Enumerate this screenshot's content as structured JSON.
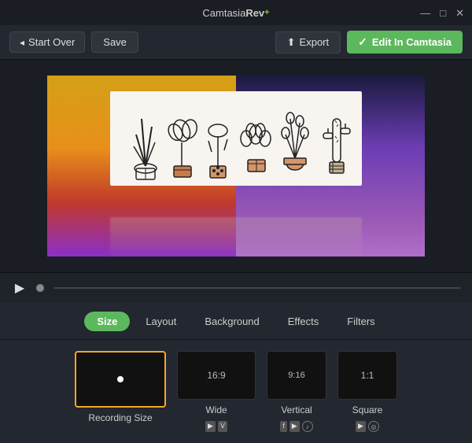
{
  "titleBar": {
    "appName": "Camtasia",
    "appNameBold": "Rev",
    "appPlus": "+",
    "controls": {
      "minimize": "—",
      "maximize": "□",
      "close": "✕"
    }
  },
  "toolbar": {
    "startOver": "Start Over",
    "save": "Save",
    "export": "Export",
    "editInCamtasia": "Edit In Camtasia"
  },
  "tabs": [
    {
      "id": "size",
      "label": "Size",
      "active": true
    },
    {
      "id": "layout",
      "label": "Layout",
      "active": false
    },
    {
      "id": "background",
      "label": "Background",
      "active": false
    },
    {
      "id": "effects",
      "label": "Effects",
      "active": false
    },
    {
      "id": "filters",
      "label": "Filters",
      "active": false
    }
  ],
  "presets": [
    {
      "id": "recording",
      "label": "Recording Size",
      "ratio": "",
      "size": "recording",
      "selected": true,
      "icons": []
    },
    {
      "id": "wide",
      "label": "Wide",
      "ratio": "16:9",
      "size": "wide",
      "selected": false,
      "icons": [
        "yt",
        "vimeo"
      ]
    },
    {
      "id": "vertical",
      "label": "Vertical",
      "ratio": "9:16",
      "size": "vertical",
      "selected": false,
      "icons": [
        "fb",
        "yt",
        "circle"
      ]
    },
    {
      "id": "square",
      "label": "Square",
      "ratio": "1:1",
      "size": "square",
      "selected": false,
      "icons": [
        "yt",
        "circle"
      ]
    }
  ],
  "colors": {
    "activeTab": "#5cb85c",
    "selectedBorder": "#f5a623",
    "accent": "#7ed321"
  }
}
